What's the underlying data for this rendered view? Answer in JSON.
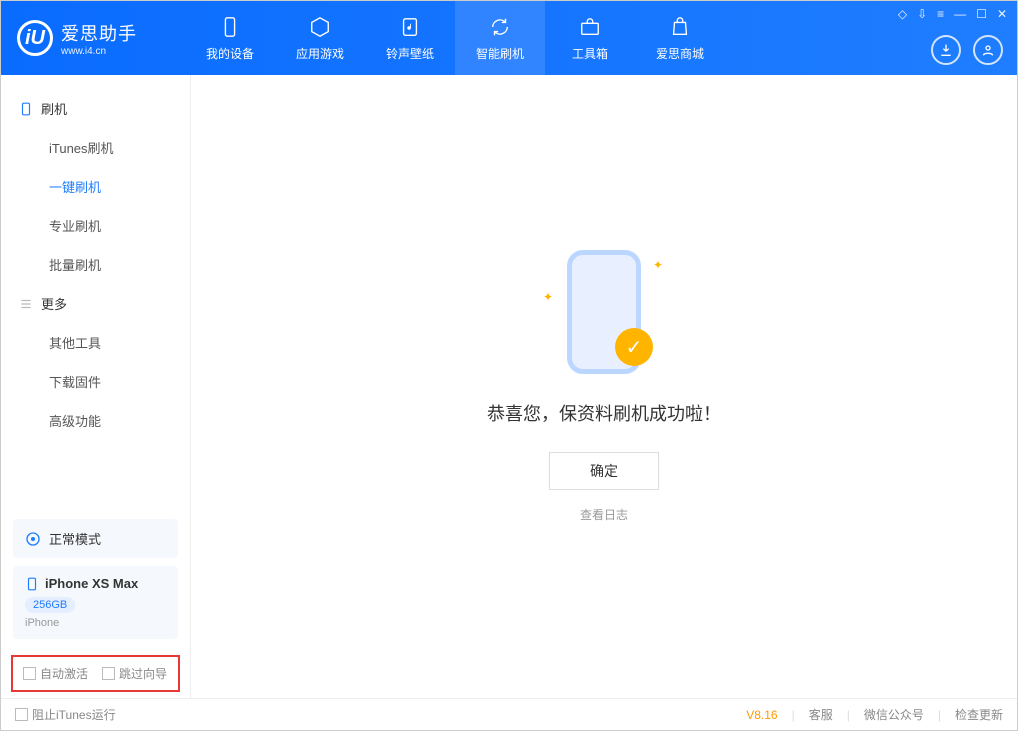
{
  "app": {
    "name_cn": "爱思助手",
    "name_en": "www.i4.cn"
  },
  "nav": {
    "items": [
      {
        "label": "我的设备"
      },
      {
        "label": "应用游戏"
      },
      {
        "label": "铃声壁纸"
      },
      {
        "label": "智能刷机"
      },
      {
        "label": "工具箱"
      },
      {
        "label": "爱思商城"
      }
    ],
    "active_index": 3
  },
  "sidebar": {
    "section1_title": "刷机",
    "section1_items": [
      "iTunes刷机",
      "一键刷机",
      "专业刷机",
      "批量刷机"
    ],
    "section1_active_index": 1,
    "section2_title": "更多",
    "section2_items": [
      "其他工具",
      "下载固件",
      "高级功能"
    ],
    "mode_label": "正常模式",
    "device_name": "iPhone XS Max",
    "device_storage": "256GB",
    "device_type": "iPhone",
    "checkbox1_label": "自动激活",
    "checkbox2_label": "跳过向导"
  },
  "main": {
    "success_text": "恭喜您，保资料刷机成功啦！",
    "ok_button": "确定",
    "log_link": "查看日志"
  },
  "footer": {
    "block_itunes": "阻止iTunes运行",
    "version": "V8.16",
    "links": [
      "客服",
      "微信公众号",
      "检查更新"
    ]
  }
}
